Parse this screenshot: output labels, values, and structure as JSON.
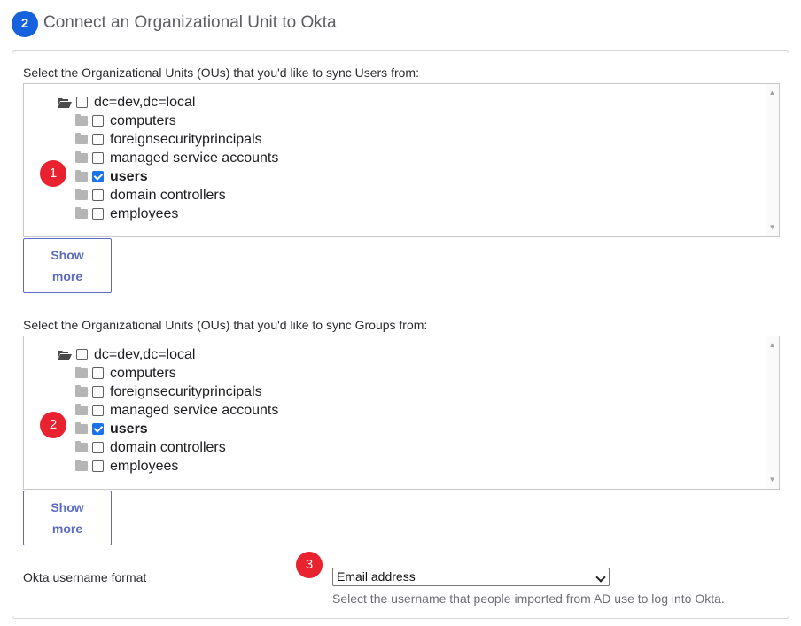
{
  "header": {
    "step_number": "2",
    "title": "Connect an Organizational Unit to Okta"
  },
  "users_section": {
    "label": "Select the Organizational Units (OUs) that you'd like to sync Users from:",
    "callout": "1",
    "root": {
      "label": "dc=dev,dc=local",
      "checked": false
    },
    "children": [
      {
        "label": "computers",
        "checked": false
      },
      {
        "label": "foreignsecurityprincipals",
        "checked": false
      },
      {
        "label": "managed service accounts",
        "checked": false
      },
      {
        "label": "users",
        "checked": true
      },
      {
        "label": "domain controllers",
        "checked": false
      },
      {
        "label": "employees",
        "checked": false
      }
    ],
    "show_more": [
      "Show",
      "more"
    ]
  },
  "groups_section": {
    "label": "Select the Organizational Units (OUs) that you'd like to sync Groups from:",
    "callout": "2",
    "root": {
      "label": "dc=dev,dc=local",
      "checked": false
    },
    "children": [
      {
        "label": "computers",
        "checked": false
      },
      {
        "label": "foreignsecurityprincipals",
        "checked": false
      },
      {
        "label": "managed service accounts",
        "checked": false
      },
      {
        "label": "users",
        "checked": true
      },
      {
        "label": "domain controllers",
        "checked": false
      },
      {
        "label": "employees",
        "checked": false
      }
    ],
    "show_more": [
      "Show",
      "more"
    ]
  },
  "username_format": {
    "label": "Okta username format",
    "callout": "3",
    "selected": "Email address",
    "help": "Select the username that people imported from AD use to log into Okta."
  },
  "colors": {
    "step_badge": "#1662dd",
    "callout": "#e8222e",
    "checkbox_checked": "#1a73e8",
    "show_more": "#5b6bbf"
  }
}
